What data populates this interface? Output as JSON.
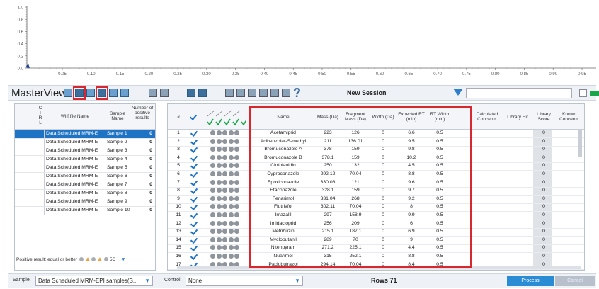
{
  "chart": {
    "y_ticks": [
      "1.0",
      "0.8",
      "0.6",
      "0.4",
      "0.2",
      "0.0"
    ],
    "x_ticks": [
      "0.05",
      "0.10",
      "0.15",
      "0.20",
      "0.25",
      "0.30",
      "0.35",
      "0.40",
      "0.45",
      "0.50",
      "0.55",
      "0.60",
      "0.65",
      "0.70",
      "0.75",
      "0.80",
      "0.85",
      "0.90",
      "0.95"
    ],
    "marker_color": "#1f3f9a"
  },
  "toolbar": {
    "title": "MasterView",
    "session_label": "New Session",
    "help_glyph": "?",
    "search_value": "",
    "icons": [
      "folder-icon",
      "save-icon",
      "table-icon",
      "export-icon",
      "lock-icon",
      "report-icon",
      "grid-icon",
      "columns-icon",
      "floppy-icon",
      "floppy-alt-icon",
      "settings-icon",
      "print-icon",
      "layout1-icon",
      "layout2-icon",
      "layout3-icon",
      "home-icon",
      "help-icon",
      "filter-icon"
    ],
    "highlight_color": "#d8282f"
  },
  "samples_panel": {
    "headers": {
      "ctrl": "C T R L",
      "wiff": "Wiff file Name",
      "sample": "Sample Name",
      "count": "Number of positive results"
    },
    "rows": [
      {
        "wiff": "Data Scheduled MRM-E",
        "sample": "Sample 1",
        "count": "0"
      },
      {
        "wiff": "Data Scheduled MRM-E",
        "sample": "Sample 2",
        "count": "0"
      },
      {
        "wiff": "Data Scheduled MRM-E",
        "sample": "Sample 3",
        "count": "0"
      },
      {
        "wiff": "Data Scheduled MRM-E",
        "sample": "Sample 4",
        "count": "0"
      },
      {
        "wiff": "Data Scheduled MRM-E",
        "sample": "Sample 5",
        "count": "0"
      },
      {
        "wiff": "Data Scheduled MRM-E",
        "sample": "Sample 6",
        "count": "0"
      },
      {
        "wiff": "Data Scheduled MRM-E",
        "sample": "Sample 7",
        "count": "0"
      },
      {
        "wiff": "Data Scheduled MRM-E",
        "sample": "Sample 8",
        "count": "0"
      },
      {
        "wiff": "Data Scheduled MRM-E",
        "sample": "Sample 9",
        "count": "0"
      },
      {
        "wiff": "Data Scheduled MRM-E",
        "sample": "Sample 10",
        "count": "0"
      }
    ],
    "footer_text": "Positive result: equal or better",
    "footer_suffix": "5C"
  },
  "results_grid": {
    "headers": {
      "num": "#",
      "name": "Name",
      "mass": "Mass (Da)",
      "fragment": "Fragment Mass (Da)",
      "width": "Width (Da)",
      "expected_rt": "Expected RT (min)",
      "rt_width": "RT Width (min)",
      "calc_conc": "Calculated Concentr.",
      "library_hit": "Library Hit",
      "library_score": "Library Score",
      "known_conc": "Known Concentr."
    },
    "rows": [
      {
        "n": "1",
        "name": "Acetamiprid",
        "mass": "223",
        "frag": "126",
        "width": "0",
        "ert": "6.6",
        "rtw": "0.5",
        "score": "0"
      },
      {
        "n": "2",
        "name": "Acibenzolar-S-methyl",
        "mass": "211",
        "frag": "136.01",
        "width": "0",
        "ert": "9.5",
        "rtw": "0.5",
        "score": "0"
      },
      {
        "n": "3",
        "name": "Bromuconazole A",
        "mass": "378",
        "frag": "159",
        "width": "0",
        "ert": "9.8",
        "rtw": "0.5",
        "score": "0"
      },
      {
        "n": "4",
        "name": "Bromuconazole B",
        "mass": "378.1",
        "frag": "159",
        "width": "0",
        "ert": "10.2",
        "rtw": "0.5",
        "score": "0"
      },
      {
        "n": "5",
        "name": "Clothianidin",
        "mass": "250",
        "frag": "132",
        "width": "0",
        "ert": "4.5",
        "rtw": "0.5",
        "score": "0"
      },
      {
        "n": "6",
        "name": "Cyproconazole",
        "mass": "292.12",
        "frag": "70.04",
        "width": "0",
        "ert": "8.8",
        "rtw": "0.5",
        "score": "0"
      },
      {
        "n": "7",
        "name": "Epoxiconazole",
        "mass": "330.08",
        "frag": "121",
        "width": "0",
        "ert": "9.6",
        "rtw": "0.5",
        "score": "0"
      },
      {
        "n": "8",
        "name": "Etaconazole",
        "mass": "328.1",
        "frag": "159",
        "width": "0",
        "ert": "9.7",
        "rtw": "0.5",
        "score": "0"
      },
      {
        "n": "9",
        "name": "Fenarimol",
        "mass": "331.04",
        "frag": "268",
        "width": "0",
        "ert": "9.2",
        "rtw": "0.5",
        "score": "0"
      },
      {
        "n": "10",
        "name": "Flutriafol",
        "mass": "302.11",
        "frag": "70.04",
        "width": "0",
        "ert": "8",
        "rtw": "0.5",
        "score": "0"
      },
      {
        "n": "11",
        "name": "Imazalil",
        "mass": "297",
        "frag": "158.9",
        "width": "0",
        "ert": "9.9",
        "rtw": "0.5",
        "score": "0"
      },
      {
        "n": "12",
        "name": "Imidacloprid",
        "mass": "256",
        "frag": "209",
        "width": "0",
        "ert": "6",
        "rtw": "0.5",
        "score": "0"
      },
      {
        "n": "13",
        "name": "Metribuzin",
        "mass": "215.1",
        "frag": "187.1",
        "width": "0",
        "ert": "6.9",
        "rtw": "0.5",
        "score": "0"
      },
      {
        "n": "14",
        "name": "Myclobutanil",
        "mass": "289",
        "frag": "70",
        "width": "0",
        "ert": "9",
        "rtw": "0.5",
        "score": "0"
      },
      {
        "n": "15",
        "name": "Nitenpyram",
        "mass": "271.2",
        "frag": "225.1",
        "width": "0",
        "ert": "4.4",
        "rtw": "0.5",
        "score": "0"
      },
      {
        "n": "16",
        "name": "Nuarimol",
        "mass": "315",
        "frag": "252.1",
        "width": "0",
        "ert": "8.8",
        "rtw": "0.5",
        "score": "0"
      },
      {
        "n": "17",
        "name": "Paclobutrazol",
        "mass": "294.14",
        "frag": "70.04",
        "width": "0",
        "ert": "8.4",
        "rtw": "0.5",
        "score": "0"
      }
    ]
  },
  "statusbar": {
    "sample_label": "Sample:",
    "sample_value": "Data Scheduled MRM-EPI samples(S...",
    "control_label": "Control:",
    "control_value": "None",
    "rows_text": "Rows 71",
    "process_label": "Process",
    "cancel_label": "Cancel"
  }
}
